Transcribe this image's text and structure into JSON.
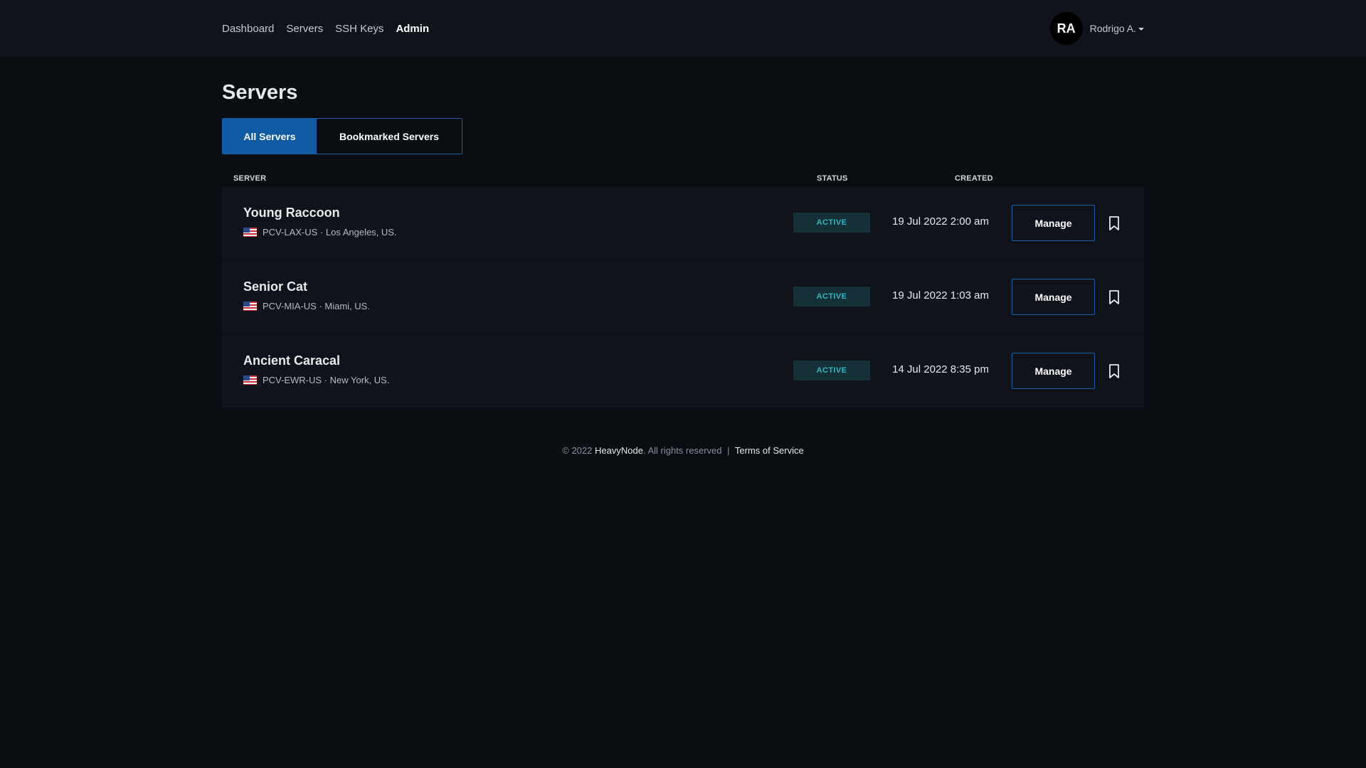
{
  "nav": {
    "items": [
      "Dashboard",
      "Servers",
      "SSH Keys",
      "Admin"
    ],
    "active": "Admin"
  },
  "user": {
    "initials": "RA",
    "name": "Rodrigo A."
  },
  "page": {
    "title": "Servers"
  },
  "tabs": [
    "All Servers",
    "Bookmarked Servers"
  ],
  "table": {
    "headers": {
      "server": "SERVER",
      "status": "STATUS",
      "created": "CREATED"
    },
    "rows": [
      {
        "name": "Young Raccoon",
        "code": "PCV-LAX-US · Los Angeles, US.",
        "status": "ACTIVE",
        "created": "19 Jul 2022 2:00 am",
        "action": "Manage"
      },
      {
        "name": "Senior Cat",
        "code": "PCV-MIA-US · Miami, US.",
        "status": "ACTIVE",
        "created": "19 Jul 2022 1:03 am",
        "action": "Manage"
      },
      {
        "name": "Ancient Caracal",
        "code": "PCV-EWR-US · New York, US.",
        "status": "ACTIVE",
        "created": "14 Jul 2022 8:35 pm",
        "action": "Manage"
      }
    ]
  },
  "footer": {
    "copyright": "© 2022",
    "brand": "HeavyNode",
    "rights": ". All rights reserved",
    "separator": "|",
    "terms": "Terms of Service"
  },
  "colors": {
    "background": "#0a0d12",
    "panel": "#10141a",
    "accent": "#0f5aa3",
    "status_text": "#2eb7c0",
    "status_bg": "#163038"
  }
}
